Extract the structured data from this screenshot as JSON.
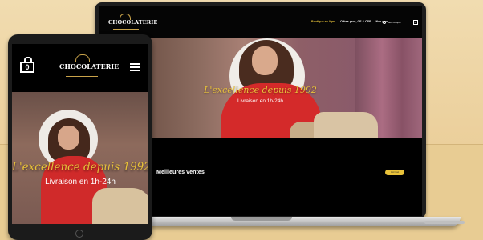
{
  "desktop": {
    "logo_text": "CHOCOLATERIE",
    "nav": [
      {
        "label": "Boutique en ligne",
        "active": true
      },
      {
        "label": "Offres pros, CE & CSE",
        "active": false
      },
      {
        "label": "Nos gros",
        "active": false
      }
    ],
    "account_label": "Mon compte",
    "cart_count": "0",
    "hero": {
      "title": "L'excellence depuis 1992",
      "subtitle": "Livraison en 1h-24h"
    },
    "best_sellers_title": "Meilleures ventes",
    "best_sellers_button": "Voir tout"
  },
  "tablet": {
    "logo_text": "CHOCOLATERIE",
    "cart_count": "0",
    "hero": {
      "title": "L'excellence depuis 1992",
      "subtitle": "Livraison en 1h-24h"
    }
  },
  "colors": {
    "accent": "#e9c23a",
    "hero_red": "#d42a2a",
    "background": "#ecd2a0"
  }
}
